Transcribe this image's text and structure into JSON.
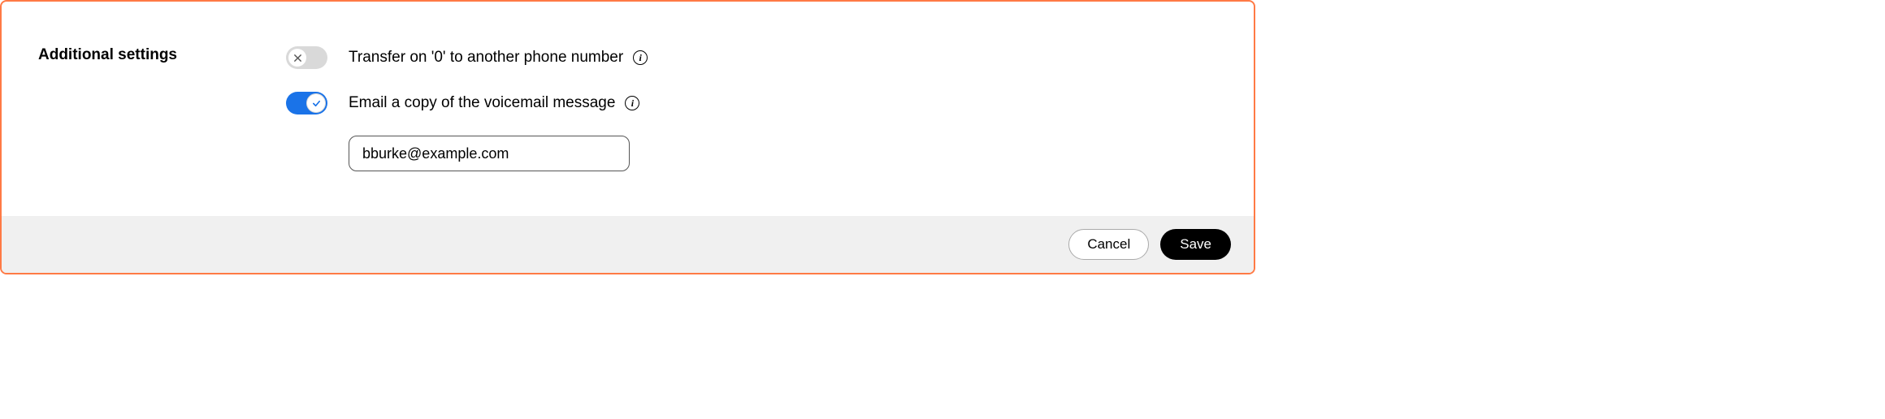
{
  "section_title": "Additional settings",
  "settings": {
    "transfer": {
      "label": "Transfer on '0' to another phone number",
      "enabled": false
    },
    "email_copy": {
      "label": "Email a copy of the voicemail message",
      "enabled": true,
      "email_value": "bburke@example.com"
    }
  },
  "footer": {
    "cancel_label": "Cancel",
    "save_label": "Save"
  }
}
